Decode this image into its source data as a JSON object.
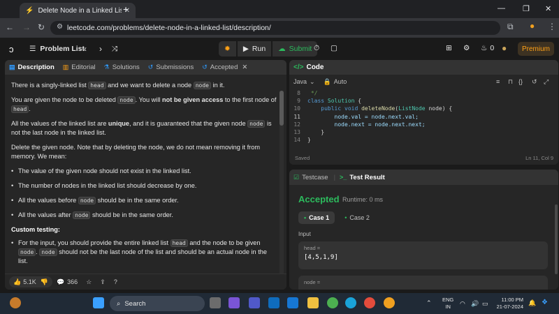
{
  "browser": {
    "tab_title": "Delete Node in a Linked List - L",
    "url": "leetcode.com/problems/delete-node-in-a-linked-list/description/"
  },
  "header": {
    "problem_list": "Problem List",
    "run": "Run",
    "submit": "Submit",
    "streak": "0",
    "premium": "Premium"
  },
  "left_tabs": [
    "Description",
    "Editorial",
    "Solutions",
    "Submissions",
    "Accepted"
  ],
  "description": {
    "p1_a": "There is a singly-linked list ",
    "p1_code": "head",
    "p1_b": " and we want to delete a node ",
    "p1_code2": "node",
    "p1_c": " in it.",
    "p2_a": "You are given the node to be deleted ",
    "p2_code": "node",
    "p2_b": ". You will ",
    "p2_bold": "not be given access",
    "p2_c": " to the first node of ",
    "p2_code2": "head",
    "p2_d": ".",
    "p3_a": "All the values of the linked list are ",
    "p3_bold": "unique",
    "p3_b": ", and it is guaranteed that the given node ",
    "p3_code": "node",
    "p3_c": " is not the last node in the linked list.",
    "p4": "Delete the given node. Note that by deleting the node, we do not mean removing it from memory. We mean:",
    "b1": "The value of the given node should not exist in the linked list.",
    "b2": "The number of nodes in the linked list should decrease by one.",
    "b3_a": "All the values before ",
    "b3_code": "node",
    "b3_b": " should be in the same order.",
    "b4_a": "All the values after ",
    "b4_code": "node",
    "b4_b": " should be in the same order.",
    "custom_testing": "Custom testing:",
    "c1_a": "For the input, you should provide the entire linked list ",
    "c1_code": "head",
    "c1_b": " and the node to be given ",
    "c1_code2": "node",
    "c1_c": ". ",
    "c1_code3": "node",
    "c1_d": " should not be the last node of the list and should be an actual node in the list."
  },
  "left_footer": {
    "likes": "5.1K",
    "comments": "366"
  },
  "code_panel": {
    "title": "Code",
    "language": "Java",
    "auto": "Auto",
    "status": "Saved",
    "cursor": "Ln 11, Col 9",
    "lines": [
      {
        "n": "8",
        "t": " */"
      },
      {
        "n": "9",
        "t": "class Solution {"
      },
      {
        "n": "10",
        "t": "    public void deleteNode(ListNode node) {"
      },
      {
        "n": "11",
        "t": "        node.val = node.next.val;"
      },
      {
        "n": "12",
        "t": "        node.next = node.next.next;"
      },
      {
        "n": "13",
        "t": "    }"
      },
      {
        "n": "14",
        "t": "}"
      }
    ]
  },
  "result_panel": {
    "tab_testcase": "Testcase",
    "tab_result": "Test Result",
    "verdict": "Accepted",
    "runtime": "Runtime: 0 ms",
    "case1": "Case 1",
    "case2": "Case 2",
    "input_label": "Input",
    "head_label": "head =",
    "head_value": "[4,5,1,9]",
    "node_label": "node ="
  },
  "taskbar": {
    "search": "Search",
    "lang_top": "ENG",
    "lang_bottom": "IN",
    "time": "11:00 PM",
    "date": "21-07-2024"
  },
  "colors": {
    "accent_green": "#2cbb5d",
    "premium_orange": "#ffa116"
  }
}
